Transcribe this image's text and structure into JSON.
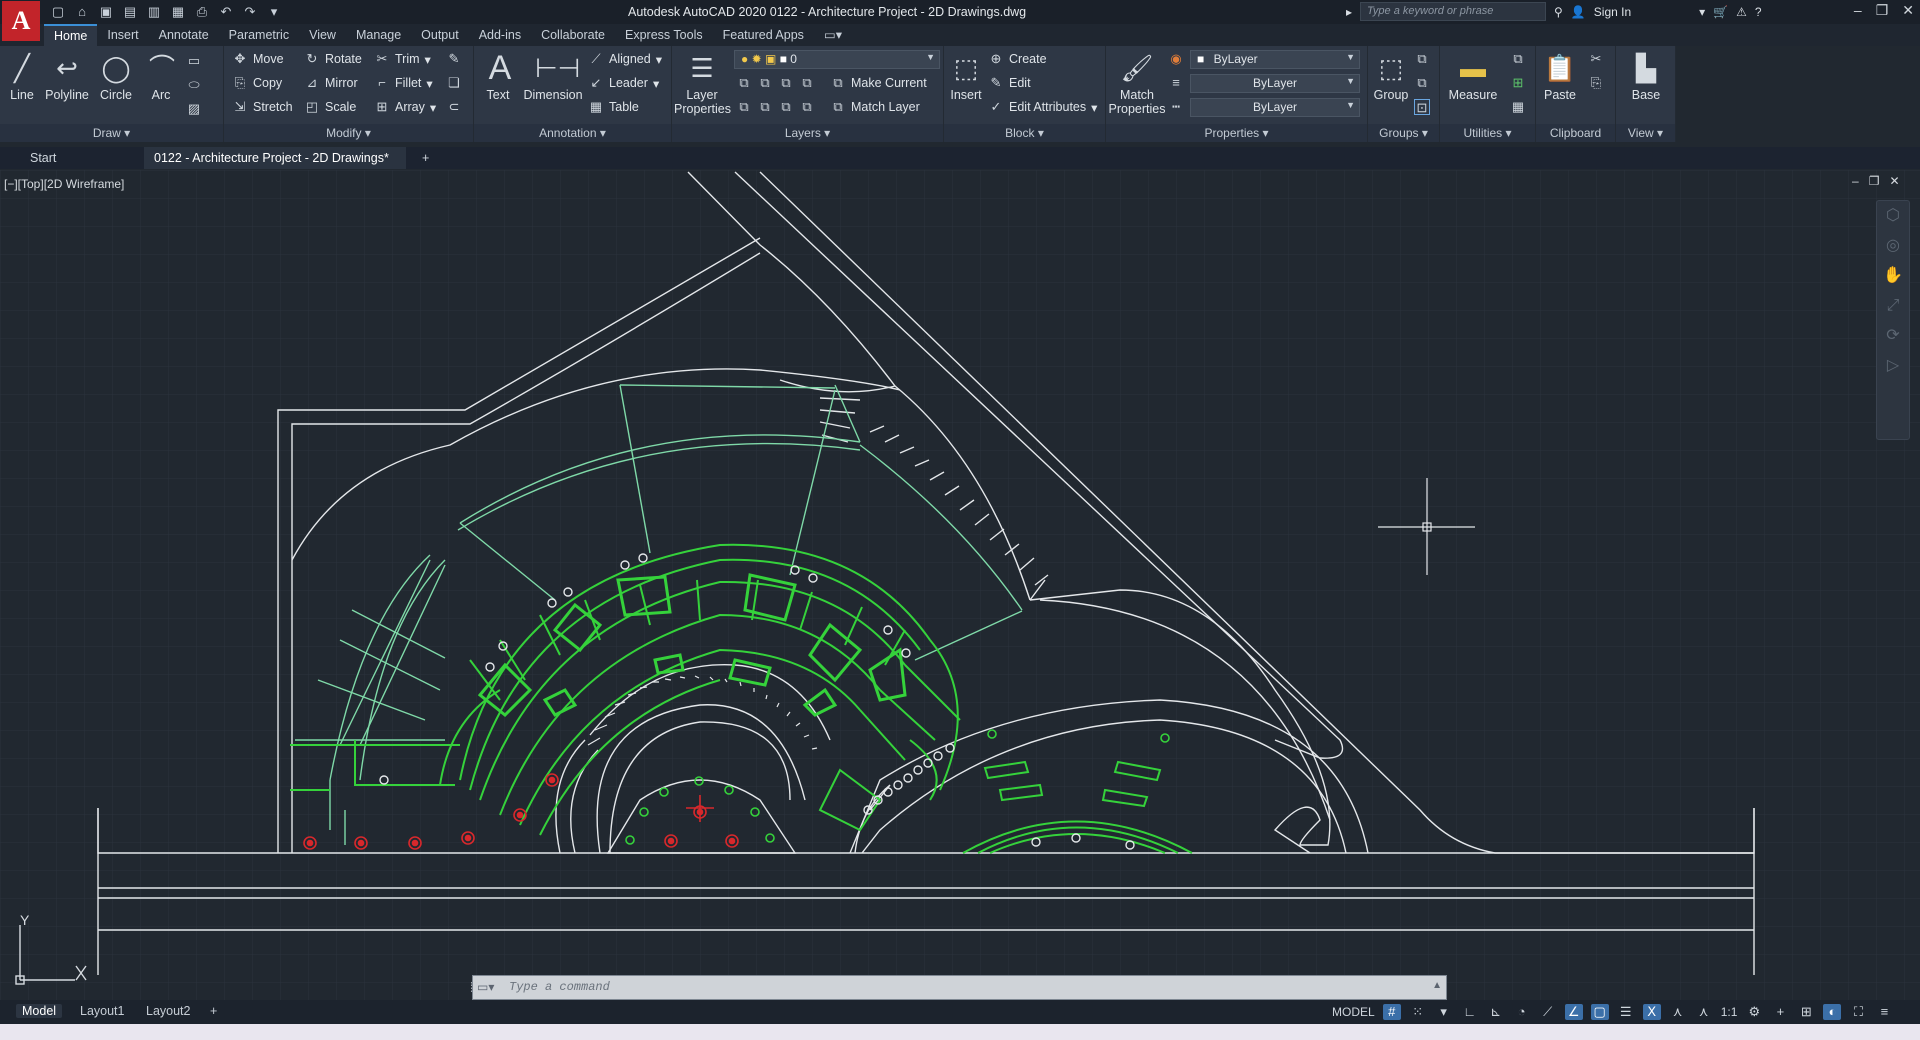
{
  "app": {
    "logo_letter": "A",
    "title": "Autodesk AutoCAD 2020    0122 - Architecture Project - 2D Drawings.dwg",
    "search_placeholder": "Type a keyword or phrase",
    "sign_in": "Sign In"
  },
  "menu": {
    "tabs": [
      "Home",
      "Insert",
      "Annotate",
      "Parametric",
      "View",
      "Manage",
      "Output",
      "Add-ins",
      "Collaborate",
      "Express Tools",
      "Featured Apps"
    ]
  },
  "ribbon": {
    "draw": {
      "line": "Line",
      "polyline": "Polyline",
      "circle": "Circle",
      "arc": "Arc",
      "label": "Draw ▾"
    },
    "modify": {
      "move": "Move",
      "rotate": "Rotate",
      "trim": "Trim",
      "copy": "Copy",
      "mirror": "Mirror",
      "fillet": "Fillet",
      "stretch": "Stretch",
      "scale": "Scale",
      "array": "Array",
      "label": "Modify ▾"
    },
    "annotation": {
      "text": "Text",
      "dimension": "Dimension",
      "aligned": "Aligned",
      "leader": "Leader",
      "table": "Table",
      "label": "Annotation ▾"
    },
    "layers": {
      "layer_properties_1": "Layer",
      "layer_properties_2": "Properties",
      "layer_value": "0",
      "make_current": "Make Current",
      "match_layer": "Match Layer",
      "label": "Layers ▾"
    },
    "block": {
      "insert": "Insert",
      "create": "Create",
      "edit": "Edit",
      "edit_attributes": "Edit Attributes",
      "label": "Block ▾"
    },
    "properties": {
      "match_1": "Match",
      "match_2": "Properties",
      "color": "ByLayer",
      "linetype": "ByLayer",
      "lineweight": "ByLayer",
      "label": "Properties ▾"
    },
    "groups": {
      "group": "Group",
      "label": "Groups ▾"
    },
    "utilities": {
      "measure": "Measure",
      "label": "Utilities ▾"
    },
    "clipboard": {
      "paste": "Paste",
      "label": "Clipboard"
    },
    "view": {
      "base": "Base",
      "label": "View ▾"
    }
  },
  "file_tabs": {
    "start": "Start",
    "drawing": "0122 - Architecture Project - 2D Drawings*",
    "close": "✕",
    "add": "+"
  },
  "viewport": {
    "label": "[−][Top][2D Wireframe]",
    "ucs_y": "Y",
    "ucs_x": "X"
  },
  "command": {
    "placeholder": "Type a command"
  },
  "status": {
    "layouts": [
      "Model",
      "Layout1",
      "Layout2"
    ],
    "add": "+",
    "model": "MODEL",
    "scale": "1:1"
  },
  "colors": {
    "accent": "#3b8fd6",
    "green": "#35d23b",
    "light_green": "#7fd9a8",
    "red": "#d8282c",
    "line": "#e4e7ea"
  }
}
